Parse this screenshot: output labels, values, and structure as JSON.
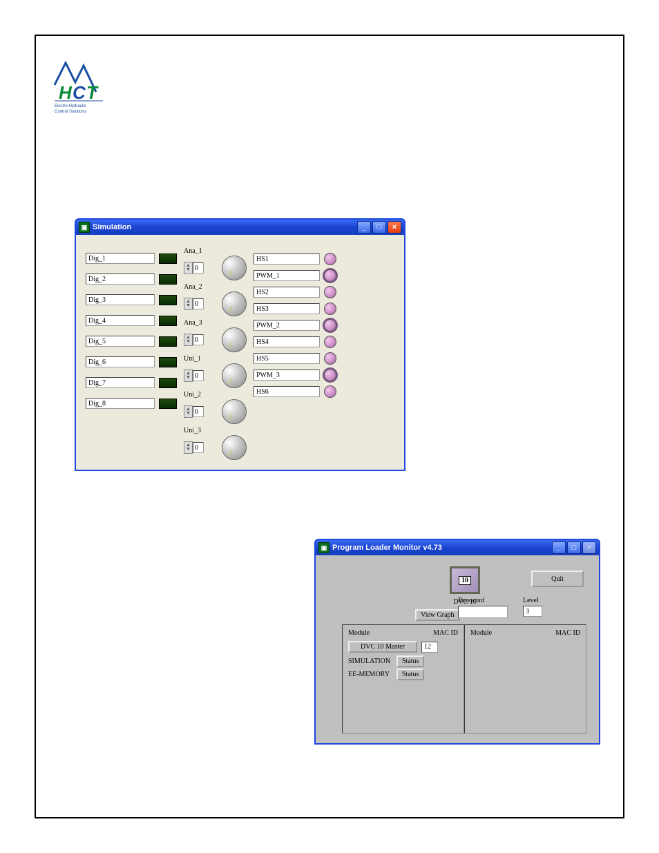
{
  "logo": {
    "line1": "Electro-Hydraulic",
    "line2": "Control Solutions"
  },
  "simulation": {
    "title": "Simulation",
    "dig": [
      "Dig_1",
      "Dig_2",
      "Dig_3",
      "Dig_4",
      "Dig_5",
      "Dig_6",
      "Dig_7",
      "Dig_8"
    ],
    "ana": [
      {
        "label": "Ana_1",
        "value": "0"
      },
      {
        "label": "Ana_2",
        "value": "0"
      },
      {
        "label": "Ana_3",
        "value": "0"
      },
      {
        "label": "Uni_1",
        "value": "0"
      },
      {
        "label": "Uni_2",
        "value": "0"
      },
      {
        "label": "Uni_3",
        "value": "0"
      }
    ],
    "out": [
      {
        "label": "HS1",
        "ring": false
      },
      {
        "label": "PWM_1",
        "ring": true
      },
      {
        "label": "HS2",
        "ring": false
      },
      {
        "label": "HS3",
        "ring": false
      },
      {
        "label": "PWM_2",
        "ring": true
      },
      {
        "label": "HS4",
        "ring": false
      },
      {
        "label": "HS5",
        "ring": false
      },
      {
        "label": "PWM_3",
        "ring": true
      },
      {
        "label": "HS6",
        "ring": false
      }
    ]
  },
  "plm": {
    "title": "Program Loader Monitor v4.73",
    "dvc_icon_text": "10",
    "dvc_label": "DVC 10",
    "view_graph": "View Graph",
    "quit": "Quit",
    "password_label": "Password",
    "level_label": "Level",
    "level_value": "3",
    "module_header": "Module",
    "macid_header": "MAC ID",
    "master_btn": "DVC 10 Master",
    "master_mac": "12",
    "simulation_label": "SIMULATION",
    "eememory_label": "EE-MEMORY",
    "status_btn": "Status"
  }
}
